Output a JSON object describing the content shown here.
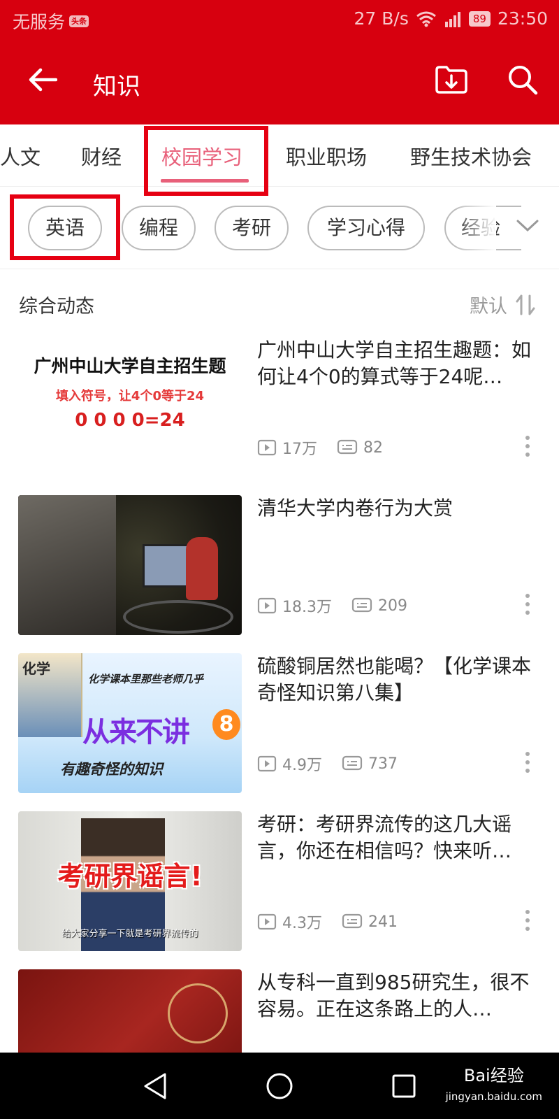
{
  "status_bar": {
    "carrier": "无服务",
    "badge": "头条",
    "net_speed": "27 B/s",
    "battery": "89",
    "time": "23:50"
  },
  "app_bar": {
    "title": "知识",
    "back_icon": "back-arrow-icon",
    "download_icon": "download-folder-icon",
    "search_icon": "search-icon"
  },
  "tabs": {
    "items": [
      "人文",
      "财经",
      "校园学习",
      "职业职场",
      "野生技术协会"
    ],
    "active": "校园学习"
  },
  "chips": {
    "items": [
      "英语",
      "编程",
      "考研",
      "学习心得",
      "经验"
    ],
    "expand_icon": "chevron-down-icon"
  },
  "section": {
    "title": "综合动态",
    "sort_label": "默认",
    "sort_icon": "sort-icon"
  },
  "feed": [
    {
      "title": "广州中山大学自主招生趣题：如何让4个0的算式等于24呢…",
      "views": "17万",
      "comments": "82",
      "thumb_text": {
        "line1": "广州中山大学自主招生题",
        "line2": "填入符号，让4个0等于24",
        "line3": "0 0 0 0=24"
      }
    },
    {
      "title": "清华大学内卷行为大赏",
      "views": "18.3万",
      "comments": "209"
    },
    {
      "title": "硫酸铜居然也能喝？【化学课本奇怪知识第八集】",
      "views": "4.9万",
      "comments": "737",
      "thumb_text": {
        "book": "化学",
        "line1": "化学课本里那些老师几乎",
        "line2": "从来不讲",
        "num": "8",
        "line3": "有趣奇怪的知识"
      }
    },
    {
      "title": "考研：考研界流传的这几大谣言，你还在相信吗？快来听…",
      "views": "4.3万",
      "comments": "241",
      "thumb_text": {
        "line1": "考研界谣言!",
        "caption": "给大家分享一下就是考研界流传的"
      }
    },
    {
      "title": "从专科一直到985研究生，很不容易。正在这条路上的人…",
      "views": "",
      "comments": ""
    }
  ],
  "watermark": {
    "line1": "Bai经验",
    "line2": "jingyan.baidu.com"
  },
  "colors": {
    "brand_red": "#d7000f",
    "tab_active": "#e8607a",
    "highlight_box": "#e60012"
  }
}
